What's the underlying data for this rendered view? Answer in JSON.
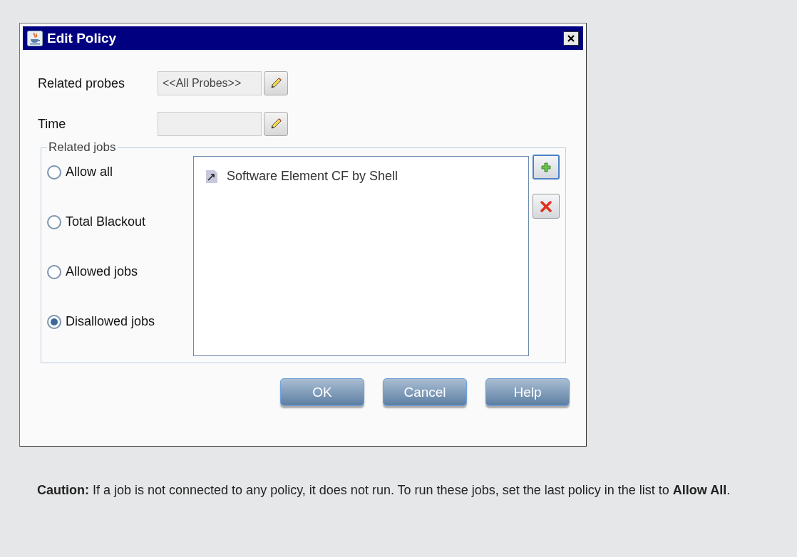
{
  "dialog": {
    "title": "Edit Policy",
    "fields": [
      {
        "label": "Related probes",
        "value": "<<All Probes>>"
      },
      {
        "label": "Time"
      }
    ],
    "related_jobs": {
      "legend": "Related jobs",
      "options": [
        {
          "label": "Allow all",
          "selected": false
        },
        {
          "label": "Total Blackout",
          "selected": false
        },
        {
          "label": "Allowed jobs",
          "selected": false
        },
        {
          "label": "Disallowed jobs",
          "selected": true
        }
      ],
      "items": [
        {
          "label": "Software Element CF by Shell"
        }
      ]
    },
    "buttons": [
      "OK",
      "Cancel",
      "Help"
    ]
  },
  "note": "**Caution:** If a job is not connected to any policy, it does not run. To run these jobs, set the last policy in the list to **Allow All**."
}
